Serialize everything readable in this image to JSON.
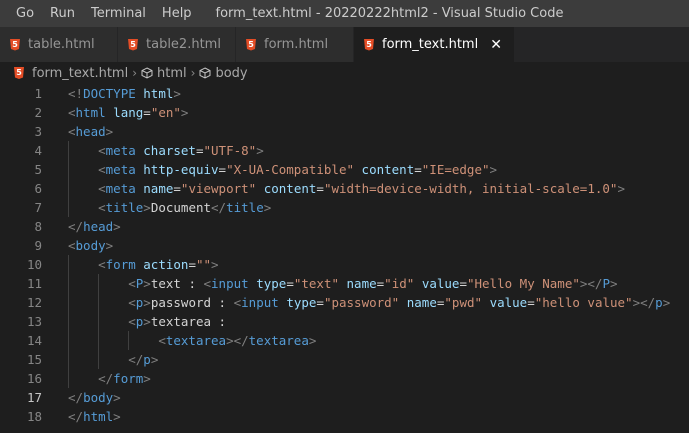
{
  "menu": [
    "Go",
    "Run",
    "Terminal",
    "Help"
  ],
  "window_title": "form_text.html - 20220222html2 - Visual Studio Code",
  "tabs": [
    {
      "label": "table.html",
      "active": false
    },
    {
      "label": "table2.html",
      "active": false
    },
    {
      "label": "form.html",
      "active": false
    },
    {
      "label": "form_text.html",
      "active": true
    }
  ],
  "icons": {
    "html5": "html5-file-icon",
    "symbol": "cube-symbol-icon",
    "close": "close-icon",
    "html5_glyph": "5"
  },
  "breadcrumb": [
    "form_text.html",
    "html",
    "body"
  ],
  "current_line": 17,
  "lines": [
    {
      "n": 1,
      "indent": 0,
      "tokens": [
        [
          "b",
          "<!"
        ],
        [
          "t",
          "DOCTYPE"
        ],
        [
          "x",
          " "
        ],
        [
          "a",
          "html"
        ],
        [
          "b",
          ">"
        ]
      ]
    },
    {
      "n": 2,
      "indent": 0,
      "tokens": [
        [
          "b",
          "<"
        ],
        [
          "t",
          "html"
        ],
        [
          "x",
          " "
        ],
        [
          "a",
          "lang"
        ],
        [
          "x",
          "="
        ],
        [
          "s",
          "\"en\""
        ],
        [
          "b",
          ">"
        ]
      ]
    },
    {
      "n": 3,
      "indent": 0,
      "tokens": [
        [
          "b",
          "<"
        ],
        [
          "t",
          "head"
        ],
        [
          "b",
          ">"
        ]
      ]
    },
    {
      "n": 4,
      "indent": 1,
      "tokens": [
        [
          "b",
          "<"
        ],
        [
          "t",
          "meta"
        ],
        [
          "x",
          " "
        ],
        [
          "a",
          "charset"
        ],
        [
          "x",
          "="
        ],
        [
          "s",
          "\"UTF-8\""
        ],
        [
          "b",
          ">"
        ]
      ]
    },
    {
      "n": 5,
      "indent": 1,
      "tokens": [
        [
          "b",
          "<"
        ],
        [
          "t",
          "meta"
        ],
        [
          "x",
          " "
        ],
        [
          "a",
          "http-equiv"
        ],
        [
          "x",
          "="
        ],
        [
          "s",
          "\"X-UA-Compatible\""
        ],
        [
          "x",
          " "
        ],
        [
          "a",
          "content"
        ],
        [
          "x",
          "="
        ],
        [
          "s",
          "\"IE=edge\""
        ],
        [
          "b",
          ">"
        ]
      ]
    },
    {
      "n": 6,
      "indent": 1,
      "tokens": [
        [
          "b",
          "<"
        ],
        [
          "t",
          "meta"
        ],
        [
          "x",
          " "
        ],
        [
          "a",
          "name"
        ],
        [
          "x",
          "="
        ],
        [
          "s",
          "\"viewport\""
        ],
        [
          "x",
          " "
        ],
        [
          "a",
          "content"
        ],
        [
          "x",
          "="
        ],
        [
          "s",
          "\"width=device-width, initial-scale=1.0\""
        ],
        [
          "b",
          ">"
        ]
      ]
    },
    {
      "n": 7,
      "indent": 1,
      "tokens": [
        [
          "b",
          "<"
        ],
        [
          "t",
          "title"
        ],
        [
          "b",
          ">"
        ],
        [
          "x",
          "Document"
        ],
        [
          "b",
          "</"
        ],
        [
          "t",
          "title"
        ],
        [
          "b",
          ">"
        ]
      ]
    },
    {
      "n": 8,
      "indent": 0,
      "tokens": [
        [
          "b",
          "</"
        ],
        [
          "t",
          "head"
        ],
        [
          "b",
          ">"
        ]
      ]
    },
    {
      "n": 9,
      "indent": 0,
      "tokens": [
        [
          "b",
          "<"
        ],
        [
          "t",
          "body"
        ],
        [
          "b",
          ">"
        ]
      ]
    },
    {
      "n": 10,
      "indent": 1,
      "tokens": [
        [
          "b",
          "<"
        ],
        [
          "t",
          "form"
        ],
        [
          "x",
          " "
        ],
        [
          "a",
          "action"
        ],
        [
          "x",
          "="
        ],
        [
          "s",
          "\"\""
        ],
        [
          "b",
          ">"
        ]
      ]
    },
    {
      "n": 11,
      "indent": 2,
      "tokens": [
        [
          "b",
          "<"
        ],
        [
          "t",
          "P"
        ],
        [
          "b",
          ">"
        ],
        [
          "x",
          "text : "
        ],
        [
          "b",
          "<"
        ],
        [
          "t",
          "input"
        ],
        [
          "x",
          " "
        ],
        [
          "a",
          "type"
        ],
        [
          "x",
          "="
        ],
        [
          "s",
          "\"text\""
        ],
        [
          "x",
          " "
        ],
        [
          "a",
          "name"
        ],
        [
          "x",
          "="
        ],
        [
          "s",
          "\"id\""
        ],
        [
          "x",
          " "
        ],
        [
          "a",
          "value"
        ],
        [
          "x",
          "="
        ],
        [
          "s",
          "\"Hello My Name\""
        ],
        [
          "b",
          ">"
        ],
        [
          "b",
          "</"
        ],
        [
          "t",
          "P"
        ],
        [
          "b",
          ">"
        ]
      ]
    },
    {
      "n": 12,
      "indent": 2,
      "tokens": [
        [
          "b",
          "<"
        ],
        [
          "t",
          "p"
        ],
        [
          "b",
          ">"
        ],
        [
          "x",
          "password : "
        ],
        [
          "b",
          "<"
        ],
        [
          "t",
          "input"
        ],
        [
          "x",
          " "
        ],
        [
          "a",
          "type"
        ],
        [
          "x",
          "="
        ],
        [
          "s",
          "\"password\""
        ],
        [
          "x",
          " "
        ],
        [
          "a",
          "name"
        ],
        [
          "x",
          "="
        ],
        [
          "s",
          "\"pwd\""
        ],
        [
          "x",
          " "
        ],
        [
          "a",
          "value"
        ],
        [
          "x",
          "="
        ],
        [
          "s",
          "\"hello value\""
        ],
        [
          "b",
          ">"
        ],
        [
          "b",
          "</"
        ],
        [
          "t",
          "p"
        ],
        [
          "b",
          ">"
        ]
      ]
    },
    {
      "n": 13,
      "indent": 2,
      "tokens": [
        [
          "b",
          "<"
        ],
        [
          "t",
          "p"
        ],
        [
          "b",
          ">"
        ],
        [
          "x",
          "textarea :"
        ]
      ]
    },
    {
      "n": 14,
      "indent": 3,
      "tokens": [
        [
          "b",
          "<"
        ],
        [
          "t",
          "textarea"
        ],
        [
          "b",
          ">"
        ],
        [
          "b",
          "</"
        ],
        [
          "t",
          "textarea"
        ],
        [
          "b",
          ">"
        ]
      ]
    },
    {
      "n": 15,
      "indent": 2,
      "tokens": [
        [
          "b",
          "</"
        ],
        [
          "t",
          "p"
        ],
        [
          "b",
          ">"
        ]
      ]
    },
    {
      "n": 16,
      "indent": 1,
      "tokens": [
        [
          "b",
          "</"
        ],
        [
          "t",
          "form"
        ],
        [
          "b",
          ">"
        ]
      ]
    },
    {
      "n": 17,
      "indent": 0,
      "tokens": [
        [
          "b",
          "</"
        ],
        [
          "t",
          "body"
        ],
        [
          "b",
          ">"
        ]
      ]
    },
    {
      "n": 18,
      "indent": 0,
      "tokens": [
        [
          "b",
          "</"
        ],
        [
          "t",
          "html"
        ],
        [
          "b",
          ">"
        ]
      ]
    }
  ]
}
